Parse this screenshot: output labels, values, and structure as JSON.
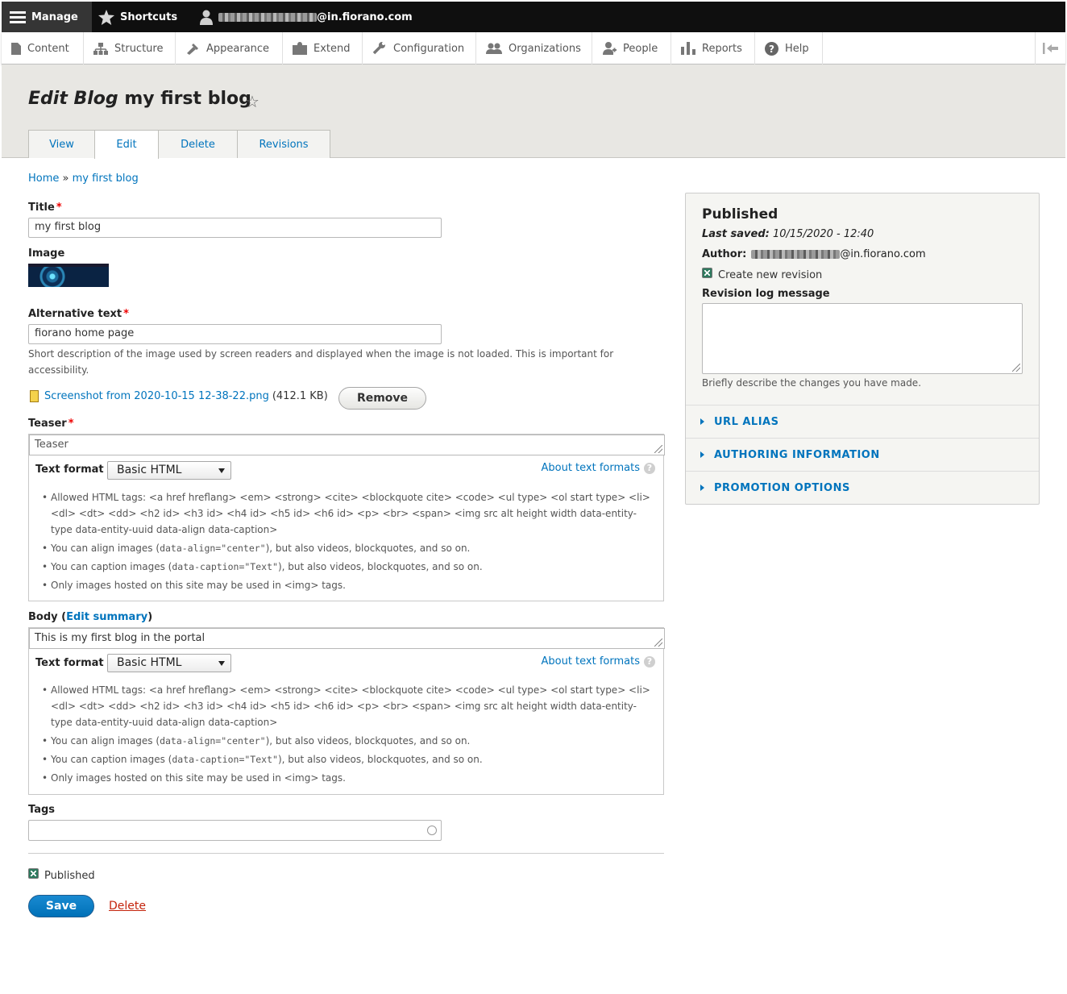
{
  "toolbar": {
    "manage": "Manage",
    "shortcuts": "Shortcuts",
    "user_domain": "@in.fiorano.com"
  },
  "tray": {
    "items": [
      "Content",
      "Structure",
      "Appearance",
      "Extend",
      "Configuration",
      "Organizations",
      "People",
      "Reports",
      "Help"
    ]
  },
  "header": {
    "title_em": "Edit Blog",
    "title_rest": "my first blog",
    "tabs": [
      "View",
      "Edit",
      "Delete",
      "Revisions"
    ]
  },
  "breadcrumb": {
    "home": "Home",
    "sep": "»",
    "current": "my first blog"
  },
  "form": {
    "title_label": "Title",
    "title_value": "my first blog",
    "image_label": "Image",
    "alt_label": "Alternative text",
    "alt_value": "fiorano home page",
    "alt_desc": "Short description of the image used by screen readers and displayed when the image is not loaded. This is important for accessibility.",
    "file_name": "Screenshot from 2020-10-15 12-38-22.png",
    "file_size": "(412.1 KB)",
    "remove_label": "Remove",
    "teaser_label": "Teaser",
    "teaser_placeholder": "Teaser",
    "text_format_label": "Text format",
    "text_format_value": "Basic HTML",
    "about_formats": "About text formats",
    "tips": {
      "allowed": "Allowed HTML tags: <a href hreflang> <em> <strong> <cite> <blockquote cite> <code> <ul type> <ol start type> <li> <dl> <dt> <dd> <h2 id> <h3 id> <h4 id> <h5 id> <h6 id> <p> <br> <span> <img src alt height width data-entity-type data-entity-uuid data-align data-caption>",
      "align_pre": "You can align images (",
      "align_code": "data-align=\"center\"",
      "align_post": "), but also videos, blockquotes, and so on.",
      "caption_pre": "You can caption images (",
      "caption_code": "data-caption=\"Text\"",
      "caption_post": "), but also videos, blockquotes, and so on.",
      "hosted": "Only images hosted on this site may be used in <img> tags."
    },
    "body_label": "Body (",
    "edit_summary": "Edit summary",
    "body_label_end": ")",
    "body_value": "This is my first blog in the portal",
    "tags_label": "Tags",
    "published_label": "Published",
    "save_label": "Save",
    "delete_label": "Delete"
  },
  "sidebar": {
    "status": "Published",
    "last_saved_label": "Last saved:",
    "last_saved_value": "10/15/2020 - 12:40",
    "author_label": "Author:",
    "author_domain": "@in.fiorano.com",
    "create_revision": "Create new revision",
    "revision_label": "Revision log message",
    "revision_desc": "Briefly describe the changes you have made.",
    "sections": [
      "URL ALIAS",
      "AUTHORING INFORMATION",
      "PROMOTION OPTIONS"
    ]
  }
}
